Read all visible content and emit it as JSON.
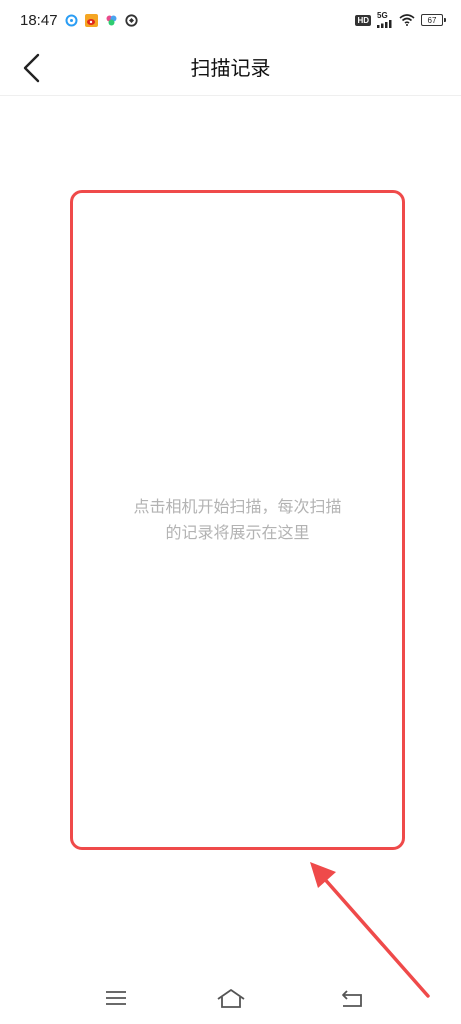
{
  "status_bar": {
    "time": "18:47",
    "app_icons": [
      "browser-icon",
      "weibo-icon",
      "photos-icon",
      "sync-icon"
    ],
    "hd": "HD",
    "network": "5G",
    "battery": "67"
  },
  "header": {
    "title": "扫描记录",
    "back_icon": "chevron-left-icon"
  },
  "empty_state": {
    "line1": "点击相机开始扫描，每次扫描",
    "line2": "的记录将展示在这里"
  },
  "annotation": {
    "color": "#ef4a4a"
  },
  "nav": {
    "items": [
      "menu-icon",
      "home-icon",
      "back-icon"
    ]
  }
}
